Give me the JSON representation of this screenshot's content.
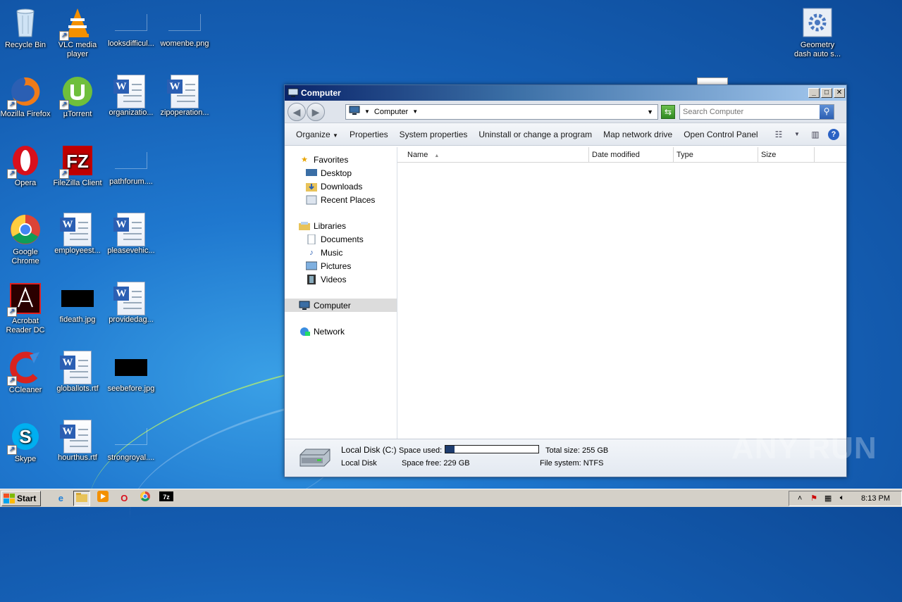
{
  "desktop": {
    "icons": [
      {
        "label": "Recycle Bin",
        "icon": "recycle-bin-icon"
      },
      {
        "label": "VLC media player",
        "icon": "vlc-icon"
      },
      {
        "label": "looksdifficul...",
        "icon": "image-file-icon"
      },
      {
        "label": "womenbe.png",
        "icon": "image-file-icon"
      },
      {
        "label": "Mozilla Firefox",
        "icon": "firefox-icon"
      },
      {
        "label": "µTorrent",
        "icon": "utorrent-icon"
      },
      {
        "label": "organizatio...",
        "icon": "word-doc-icon"
      },
      {
        "label": "zipoperation...",
        "icon": "word-doc-icon"
      },
      {
        "label": "Opera",
        "icon": "opera-icon"
      },
      {
        "label": "FileZilla Client",
        "icon": "filezilla-icon"
      },
      {
        "label": "pathforum....",
        "icon": "image-file-icon"
      },
      {
        "label": "Google Chrome",
        "icon": "chrome-icon"
      },
      {
        "label": "employeest...",
        "icon": "word-doc-icon"
      },
      {
        "label": "pleasevehic...",
        "icon": "word-doc-icon"
      },
      {
        "label": "Acrobat Reader DC",
        "icon": "acrobat-icon"
      },
      {
        "label": "fideath.jpg",
        "icon": "image-file-icon"
      },
      {
        "label": "providedag...",
        "icon": "word-doc-icon"
      },
      {
        "label": "CCleaner",
        "icon": "ccleaner-icon"
      },
      {
        "label": "globallots.rtf",
        "icon": "word-doc-icon"
      },
      {
        "label": "seebefore.jpg",
        "icon": "image-file-icon"
      },
      {
        "label": "Skype",
        "icon": "skype-icon"
      },
      {
        "label": "hourthus.rtf",
        "icon": "word-doc-icon"
      },
      {
        "label": "strongroyal....",
        "icon": "image-file-icon"
      },
      {
        "label": "Geometry dash auto s...",
        "icon": "settings-gear-icon"
      }
    ]
  },
  "window": {
    "title": "Computer",
    "address": "Computer",
    "search_placeholder": "Search Computer",
    "toolbar": {
      "organize": "Organize",
      "properties": "Properties",
      "system_properties": "System properties",
      "uninstall": "Uninstall or change a program",
      "map_drive": "Map network drive",
      "control_panel": "Open Control Panel"
    },
    "nav": {
      "favorites": "Favorites",
      "desktop": "Desktop",
      "downloads": "Downloads",
      "recent": "Recent Places",
      "libraries": "Libraries",
      "documents": "Documents",
      "music": "Music",
      "pictures": "Pictures",
      "videos": "Videos",
      "computer": "Computer",
      "network": "Network"
    },
    "columns": {
      "name": "Name",
      "date": "Date modified",
      "type": "Type",
      "size": "Size"
    },
    "details": {
      "drive_name": "Local Disk (C:)",
      "drive_type": "Local Disk",
      "space_used_label": "Space used:",
      "space_used_fraction": 0.1,
      "space_free": "Space free:  229 GB",
      "total_size": "Total size:  255 GB",
      "file_system": "File system:  NTFS"
    }
  },
  "taskbar": {
    "start": "Start",
    "clock": "8:13 PM"
  },
  "watermark": "ANY RUN"
}
